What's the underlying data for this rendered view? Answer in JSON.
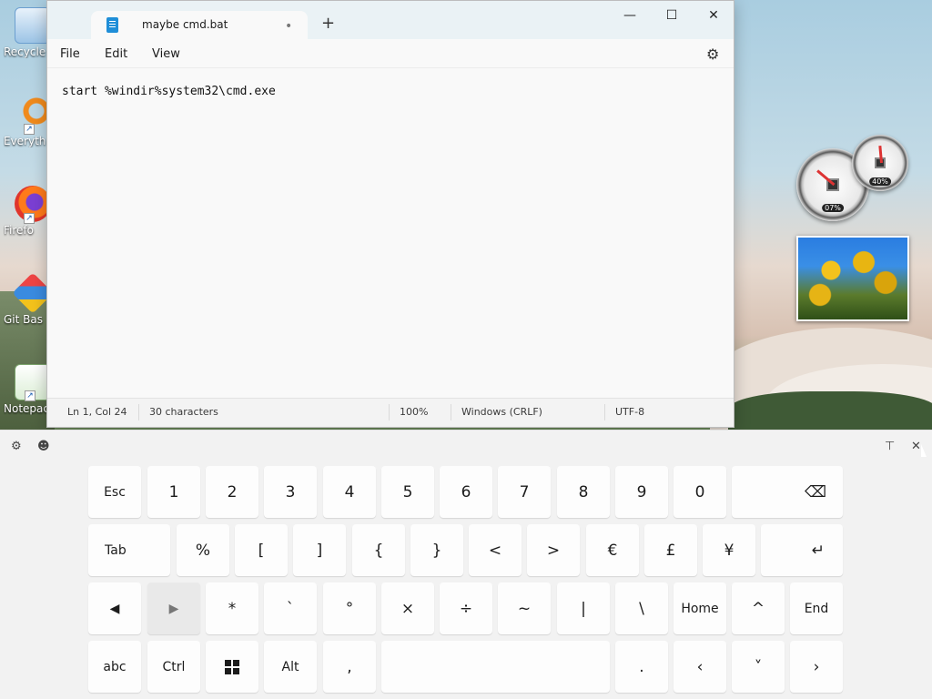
{
  "desktop": {
    "icons": [
      {
        "label": "Recycle Bin",
        "short": "Recycle"
      },
      {
        "label": "Everything",
        "short": "Everyth"
      },
      {
        "label": "Firefox",
        "short": "Firefo"
      },
      {
        "label": "Git Bash",
        "short": "Git Bas"
      },
      {
        "label": "Notepad",
        "short": "Notepac"
      }
    ],
    "gadgets": {
      "cpu_meter": {
        "cpu_value": "07%",
        "ram_value": "40%"
      },
      "photo": "tulips slideshow"
    }
  },
  "notepad": {
    "tab_title": "maybe cmd.bat",
    "unsaved_dot": "•",
    "new_tab": "+",
    "window_controls": {
      "minimize": "—",
      "maximize": "☐",
      "close": "✕"
    },
    "menu": {
      "file": "File",
      "edit": "Edit",
      "view": "View"
    },
    "settings_icon": "⚙",
    "content": "start %windir%system32\\cmd.exe",
    "status": {
      "position": "Ln 1, Col 24",
      "characters": "30 characters",
      "zoom": "100%",
      "line_ending": "Windows (CRLF)",
      "encoding": "UTF-8"
    }
  },
  "keyboard": {
    "toolbar": {
      "settings": "⚙",
      "emoji": "☻",
      "dock": "⊤",
      "close": "✕"
    },
    "row1": [
      "Esc",
      "1",
      "2",
      "3",
      "4",
      "5",
      "6",
      "7",
      "8",
      "9",
      "0",
      "⌫"
    ],
    "row2": [
      "Tab",
      "%",
      "[",
      "]",
      "{",
      "}",
      "<",
      ">",
      "€",
      "£",
      "¥",
      "↵"
    ],
    "row3": [
      "◀",
      "▶",
      "*",
      "`",
      "°",
      "×",
      "÷",
      "~",
      "|",
      "\\",
      "Home",
      "^",
      "End"
    ],
    "row4": [
      "abc",
      "Ctrl",
      "win",
      "Alt",
      ",",
      "",
      ".",
      "‹",
      "˅",
      "›"
    ]
  }
}
